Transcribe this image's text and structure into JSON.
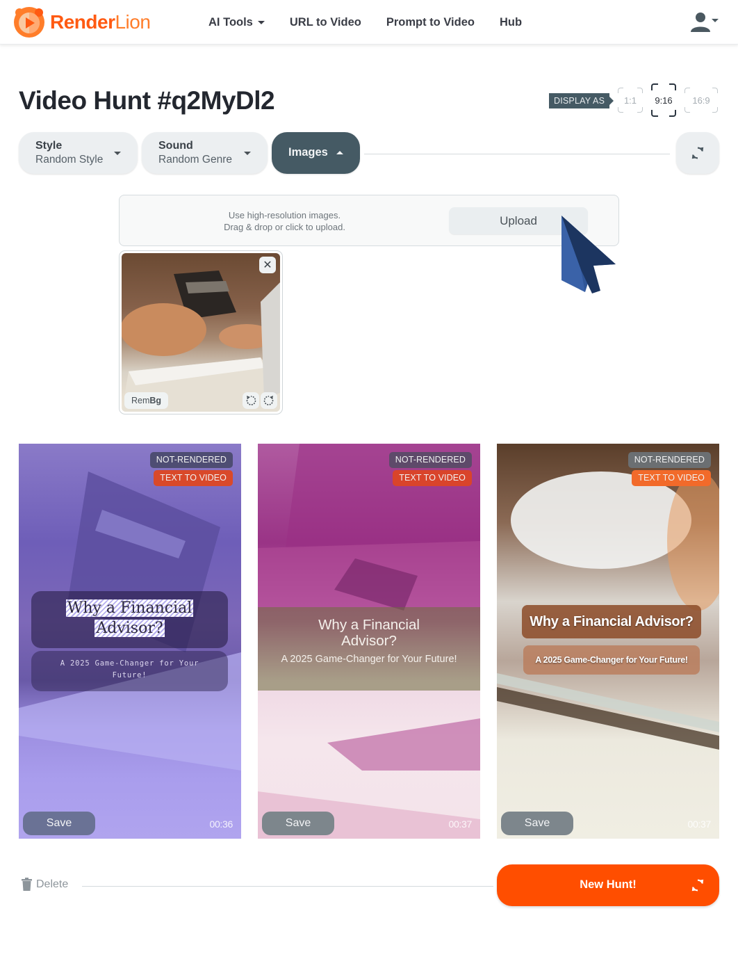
{
  "brand": {
    "name_part1": "Render",
    "name_part2": "Lion",
    "color": "#ff5a12"
  },
  "nav": {
    "items": [
      {
        "label": "AI Tools",
        "has_dropdown": true
      },
      {
        "label": "URL to Video"
      },
      {
        "label": "Prompt to Video"
      },
      {
        "label": "Hub"
      }
    ],
    "user_icon": "user-icon"
  },
  "page": {
    "title": "Video Hunt #q2MyDl2"
  },
  "display": {
    "label": "DISPLAY AS",
    "ratios": [
      {
        "label": "1:1"
      },
      {
        "label": "9:16",
        "active": true
      },
      {
        "label": "16:9"
      }
    ]
  },
  "options": {
    "style": {
      "label": "Style",
      "value": "Random Style"
    },
    "sound": {
      "label": "Sound",
      "value": "Random Genre"
    },
    "images": {
      "label": "Images",
      "expanded": true
    },
    "refresh_icon": "refresh-icon"
  },
  "upload": {
    "hint_line1": "Use high-resolution images.",
    "hint_line2": "Drag & drop or click to upload.",
    "button_label": "Upload"
  },
  "uploaded_image": {
    "rembg_part1": "Rem",
    "rembg_part2": "Bg",
    "close_icon": "close-icon",
    "rotate_left_icon": "rotate-left-icon",
    "rotate_right_icon": "rotate-right-icon"
  },
  "videos": [
    {
      "status": "NOT-RENDERED",
      "type": "TEXT TO VIDEO",
      "title": "Why a Financial Advisor?",
      "title_line1": "Why a Financial",
      "title_line2": "Advisor?",
      "subtitle": "A 2025 Game-Changer for Your Future!",
      "save_label": "Save",
      "duration": "00:36"
    },
    {
      "status": "NOT-RENDERED",
      "type": "TEXT TO VIDEO",
      "title": "Why a Financial Advisor?",
      "subtitle": "A 2025 Game-Changer for Your Future!",
      "save_label": "Save",
      "duration": "00:37"
    },
    {
      "status": "NOT-RENDERED",
      "type": "TEXT TO VIDEO",
      "title": "Why a Financial Advisor?",
      "subtitle": "A 2025 Game-Changer for Your Future!",
      "save_label": "Save",
      "duration": "00:37"
    }
  ],
  "footer": {
    "delete_label": "Delete",
    "new_hunt_label": "New Hunt!"
  },
  "colors": {
    "accent": "#ff4e00",
    "dark_slate": "#455a64",
    "pill_bg": "#eceff1"
  }
}
